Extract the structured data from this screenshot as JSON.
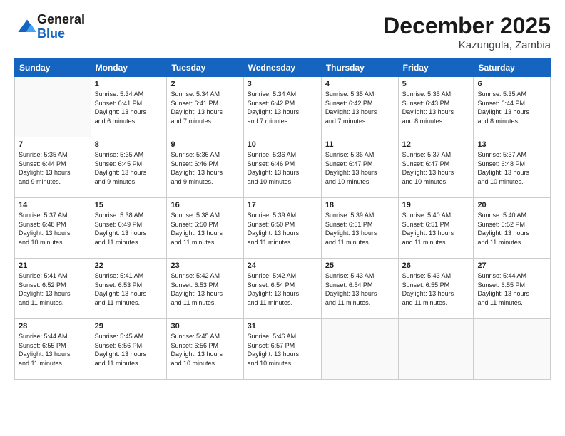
{
  "logo": {
    "line1": "General",
    "line2": "Blue"
  },
  "title": "December 2025",
  "location": "Kazungula, Zambia",
  "days_header": [
    "Sunday",
    "Monday",
    "Tuesday",
    "Wednesday",
    "Thursday",
    "Friday",
    "Saturday"
  ],
  "weeks": [
    [
      {
        "day": "",
        "info": ""
      },
      {
        "day": "1",
        "info": "Sunrise: 5:34 AM\nSunset: 6:41 PM\nDaylight: 13 hours\nand 6 minutes."
      },
      {
        "day": "2",
        "info": "Sunrise: 5:34 AM\nSunset: 6:41 PM\nDaylight: 13 hours\nand 7 minutes."
      },
      {
        "day": "3",
        "info": "Sunrise: 5:34 AM\nSunset: 6:42 PM\nDaylight: 13 hours\nand 7 minutes."
      },
      {
        "day": "4",
        "info": "Sunrise: 5:35 AM\nSunset: 6:42 PM\nDaylight: 13 hours\nand 7 minutes."
      },
      {
        "day": "5",
        "info": "Sunrise: 5:35 AM\nSunset: 6:43 PM\nDaylight: 13 hours\nand 8 minutes."
      },
      {
        "day": "6",
        "info": "Sunrise: 5:35 AM\nSunset: 6:44 PM\nDaylight: 13 hours\nand 8 minutes."
      }
    ],
    [
      {
        "day": "7",
        "info": "Sunrise: 5:35 AM\nSunset: 6:44 PM\nDaylight: 13 hours\nand 9 minutes."
      },
      {
        "day": "8",
        "info": "Sunrise: 5:35 AM\nSunset: 6:45 PM\nDaylight: 13 hours\nand 9 minutes."
      },
      {
        "day": "9",
        "info": "Sunrise: 5:36 AM\nSunset: 6:46 PM\nDaylight: 13 hours\nand 9 minutes."
      },
      {
        "day": "10",
        "info": "Sunrise: 5:36 AM\nSunset: 6:46 PM\nDaylight: 13 hours\nand 10 minutes."
      },
      {
        "day": "11",
        "info": "Sunrise: 5:36 AM\nSunset: 6:47 PM\nDaylight: 13 hours\nand 10 minutes."
      },
      {
        "day": "12",
        "info": "Sunrise: 5:37 AM\nSunset: 6:47 PM\nDaylight: 13 hours\nand 10 minutes."
      },
      {
        "day": "13",
        "info": "Sunrise: 5:37 AM\nSunset: 6:48 PM\nDaylight: 13 hours\nand 10 minutes."
      }
    ],
    [
      {
        "day": "14",
        "info": "Sunrise: 5:37 AM\nSunset: 6:48 PM\nDaylight: 13 hours\nand 10 minutes."
      },
      {
        "day": "15",
        "info": "Sunrise: 5:38 AM\nSunset: 6:49 PM\nDaylight: 13 hours\nand 11 minutes."
      },
      {
        "day": "16",
        "info": "Sunrise: 5:38 AM\nSunset: 6:50 PM\nDaylight: 13 hours\nand 11 minutes."
      },
      {
        "day": "17",
        "info": "Sunrise: 5:39 AM\nSunset: 6:50 PM\nDaylight: 13 hours\nand 11 minutes."
      },
      {
        "day": "18",
        "info": "Sunrise: 5:39 AM\nSunset: 6:51 PM\nDaylight: 13 hours\nand 11 minutes."
      },
      {
        "day": "19",
        "info": "Sunrise: 5:40 AM\nSunset: 6:51 PM\nDaylight: 13 hours\nand 11 minutes."
      },
      {
        "day": "20",
        "info": "Sunrise: 5:40 AM\nSunset: 6:52 PM\nDaylight: 13 hours\nand 11 minutes."
      }
    ],
    [
      {
        "day": "21",
        "info": "Sunrise: 5:41 AM\nSunset: 6:52 PM\nDaylight: 13 hours\nand 11 minutes."
      },
      {
        "day": "22",
        "info": "Sunrise: 5:41 AM\nSunset: 6:53 PM\nDaylight: 13 hours\nand 11 minutes."
      },
      {
        "day": "23",
        "info": "Sunrise: 5:42 AM\nSunset: 6:53 PM\nDaylight: 13 hours\nand 11 minutes."
      },
      {
        "day": "24",
        "info": "Sunrise: 5:42 AM\nSunset: 6:54 PM\nDaylight: 13 hours\nand 11 minutes."
      },
      {
        "day": "25",
        "info": "Sunrise: 5:43 AM\nSunset: 6:54 PM\nDaylight: 13 hours\nand 11 minutes."
      },
      {
        "day": "26",
        "info": "Sunrise: 5:43 AM\nSunset: 6:55 PM\nDaylight: 13 hours\nand 11 minutes."
      },
      {
        "day": "27",
        "info": "Sunrise: 5:44 AM\nSunset: 6:55 PM\nDaylight: 13 hours\nand 11 minutes."
      }
    ],
    [
      {
        "day": "28",
        "info": "Sunrise: 5:44 AM\nSunset: 6:55 PM\nDaylight: 13 hours\nand 11 minutes."
      },
      {
        "day": "29",
        "info": "Sunrise: 5:45 AM\nSunset: 6:56 PM\nDaylight: 13 hours\nand 11 minutes."
      },
      {
        "day": "30",
        "info": "Sunrise: 5:45 AM\nSunset: 6:56 PM\nDaylight: 13 hours\nand 10 minutes."
      },
      {
        "day": "31",
        "info": "Sunrise: 5:46 AM\nSunset: 6:57 PM\nDaylight: 13 hours\nand 10 minutes."
      },
      {
        "day": "",
        "info": ""
      },
      {
        "day": "",
        "info": ""
      },
      {
        "day": "",
        "info": ""
      }
    ]
  ]
}
